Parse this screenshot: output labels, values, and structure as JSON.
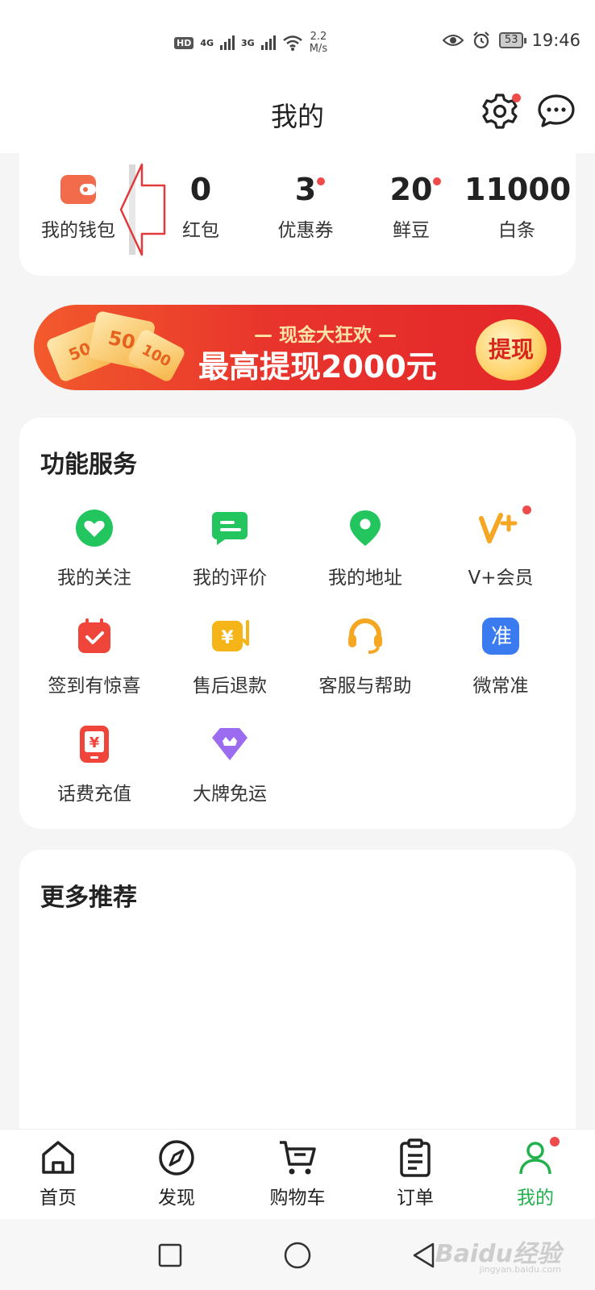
{
  "status_bar": {
    "hd": "HD",
    "sig1": "4G",
    "sig2": "3G",
    "speed_value": "2.2",
    "speed_unit": "M/s",
    "battery": "53",
    "time": "19:46"
  },
  "header": {
    "title": "我的",
    "settings_has_badge": true
  },
  "assets": {
    "wallet_label": "我的钱包",
    "items": [
      {
        "value": "0",
        "label": "红包",
        "badge": false
      },
      {
        "value": "3",
        "label": "优惠券",
        "badge": true
      },
      {
        "value": "20",
        "label": "鲜豆",
        "badge": true
      },
      {
        "value": "11000",
        "label": "白条",
        "badge": false
      }
    ]
  },
  "banner": {
    "subtitle": "— 现金大狂欢 —",
    "headline": "最高提现2000元",
    "button": "提现",
    "ticket_values": [
      "50",
      "50",
      "100"
    ]
  },
  "services": {
    "title": "功能服务",
    "items": [
      {
        "label": "我的关注",
        "icon": "heart-icon",
        "color": "#22c55e"
      },
      {
        "label": "我的评价",
        "icon": "comment-icon",
        "color": "#22c55e"
      },
      {
        "label": "我的地址",
        "icon": "location-pin-icon",
        "color": "#22c55e"
      },
      {
        "label": "V+会员",
        "icon": "vplus-icon",
        "color": "#f5a623"
      },
      {
        "label": "签到有惊喜",
        "icon": "calendar-check-icon",
        "color": "#f0453a"
      },
      {
        "label": "售后退款",
        "icon": "refund-icon",
        "color": "#f5b417"
      },
      {
        "label": "客服与帮助",
        "icon": "headset-icon",
        "color": "#f5a623"
      },
      {
        "label": "微常准",
        "icon": "weichangzhun-icon",
        "color": "#3b7bf0",
        "glyph": "准"
      },
      {
        "label": "话费充值",
        "icon": "phone-recharge-icon",
        "color": "#f0453a",
        "glyph": "¥"
      },
      {
        "label": "大牌免运",
        "icon": "crown-gem-icon",
        "color": "#9b6cf0"
      }
    ]
  },
  "more": {
    "title": "更多推荐"
  },
  "tabbar": {
    "items": [
      {
        "label": "首页",
        "icon": "home-icon"
      },
      {
        "label": "发现",
        "icon": "compass-icon"
      },
      {
        "label": "购物车",
        "icon": "cart-icon"
      },
      {
        "label": "订单",
        "icon": "order-list-icon"
      },
      {
        "label": "我的",
        "icon": "profile-icon",
        "active": true
      }
    ],
    "active_color": "#22b14c"
  },
  "watermark": {
    "text": "Baidu经验",
    "sub": "jingyan.baidu.com"
  }
}
